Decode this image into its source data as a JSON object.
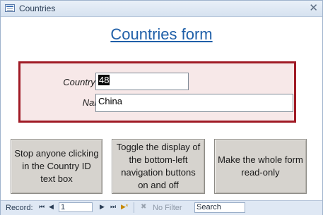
{
  "window": {
    "title": "Countries",
    "close_glyph": "✕"
  },
  "form": {
    "heading": "Countries form",
    "fields": {
      "country_id_label": "Country ID:",
      "country_id_value": "48",
      "name_label": "Name:",
      "name_value": "China"
    },
    "buttons": {
      "lock_id": "Stop anyone clicking in the Country ID text box",
      "toggle_nav": "Toggle the display of the bottom-left navigation buttons on and off",
      "read_only": "Make the whole form read-only"
    }
  },
  "navigation": {
    "record_label": "Record:",
    "first_glyph": "⏮",
    "prev_glyph": "◀",
    "current_record": "1",
    "next_glyph": "▶",
    "last_glyph": "⏭",
    "new_glyph": "▶*",
    "filter_label": "No Filter",
    "filter_icon": "funnel-icon",
    "search_label": "Search"
  },
  "colors": {
    "accent_border": "#a01a25",
    "heading_blue": "#1f5fa8",
    "nav_bg": "#dfe8f4"
  }
}
